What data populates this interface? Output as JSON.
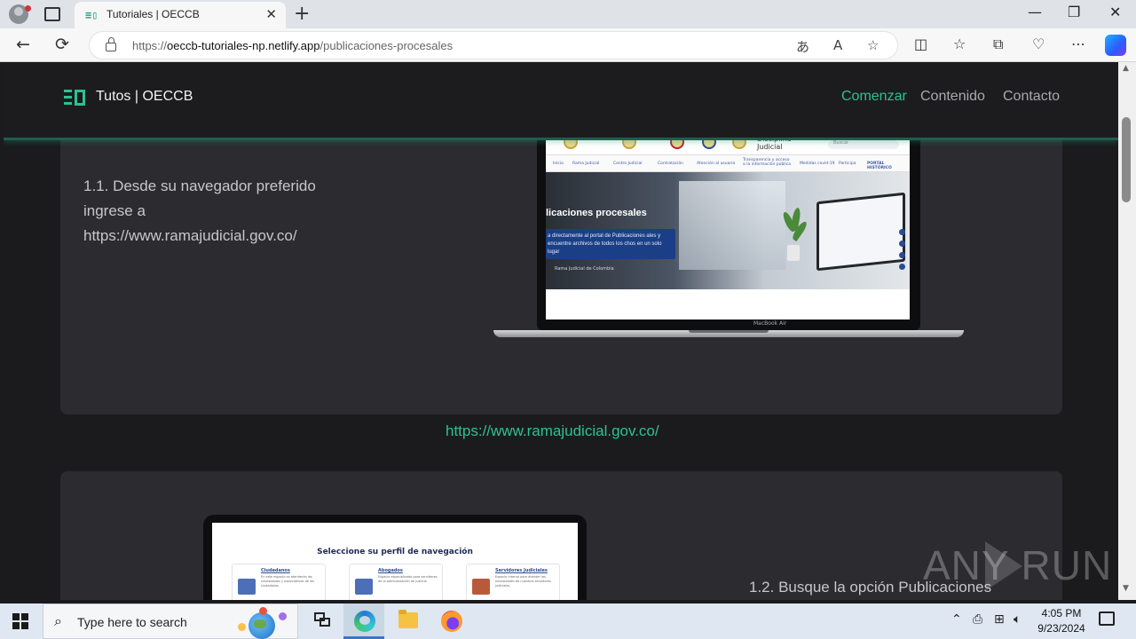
{
  "browser": {
    "tab_title": "Tutoriales | OECCB",
    "url_prefix": "https://",
    "url_host": "oeccb-tutoriales-np.netlify.app",
    "url_path": "/publicaciones-procesales",
    "tab_favicon": "≡▯",
    "icons": {
      "close": "✕",
      "new_tab": "+",
      "minimize": "—",
      "restore": "❐",
      "back": "←",
      "refresh": "⟳",
      "more": "⋯"
    }
  },
  "site": {
    "brand": "Tutos | OECCB",
    "nav": {
      "start": "Comenzar",
      "content": "Contenido",
      "contact": "Contacto"
    },
    "accent_color": "#2cc28f"
  },
  "step1": {
    "text_line1": "1.1. Desde su navegador preferido",
    "text_line2": "ingrese a",
    "text_line3": "https://www.ramajudicial.gov.co/",
    "link": "https://www.ramajudicial.gov.co/",
    "screenshot": {
      "hero_title": "licaciones procesales",
      "hero_body": "a directamente al portal de Publicaciones ales y encuentre archivos de todos los chos en un solo lugar",
      "hero_button": "Rama Judicial de Colombia",
      "brand_line1": "Disciplina",
      "brand_line2": "Judicial",
      "search_placeholder": "Buscar",
      "nav_items": [
        "Inicio",
        "Rama Judicial",
        "Centro Judicial",
        "Contratación",
        "Atención al usuario",
        "Transparencia y acceso a la información pública",
        "Medidas covid-19",
        "Participa",
        "PORTAL HISTÓRICO"
      ],
      "laptop_model": "MacBook Air"
    }
  },
  "step2": {
    "text": "1.2. Busque la opción Publicaciones",
    "screenshot": {
      "title": "Seleccione su perfil de navegación",
      "profiles": [
        {
          "name": "Ciudadanos",
          "desc": "En este espacio se atenderán las necesidades y expectativas de los ciudadanos"
        },
        {
          "name": "Abogados",
          "desc": "Espacio especializado para servidores de la administración de justicia"
        },
        {
          "name": "Servidores Judiciales",
          "desc": "Espacio interno para atender las necesidades de nuestros servidores judiciales"
        }
      ]
    }
  },
  "watermark": "ANY RUN",
  "taskbar": {
    "search_placeholder": "Type here to search",
    "time": "4:05 PM",
    "date": "9/23/2024"
  }
}
